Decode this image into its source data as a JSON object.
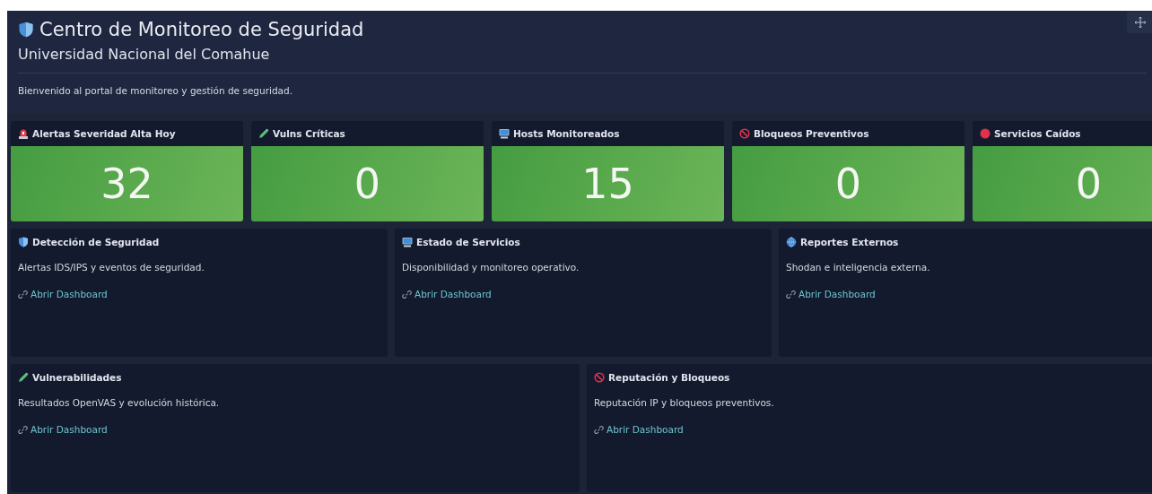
{
  "header": {
    "title": "Centro de Monitoreo de Seguridad",
    "subtitle": "Universidad Nacional del Comahue",
    "welcome": "Bienvenido al portal de monitoreo y gestión de seguridad."
  },
  "stats": [
    {
      "kind": "siren",
      "label": "Alertas Severidad Alta Hoy",
      "value": "32"
    },
    {
      "kind": "pencil",
      "label": "Vulns Críticas",
      "value": "0"
    },
    {
      "kind": "computer",
      "label": "Hosts Monitoreados",
      "value": "15"
    },
    {
      "kind": "prohibited",
      "label": "Bloqueos Preventivos",
      "value": "0"
    },
    {
      "kind": "dot",
      "label": "Servicios Caídos",
      "value": "0"
    }
  ],
  "section_rows": [
    {
      "cards": [
        {
          "kind": "shield",
          "title": "Detección de Seguridad",
          "description": "Alertas IDS/IPS y eventos de seguridad.",
          "link": "Abrir Dashboard"
        },
        {
          "kind": "computer",
          "title": "Estado de Servicios",
          "description": "Disponibilidad y monitoreo operativo.",
          "link": "Abrir Dashboard"
        },
        {
          "kind": "globe",
          "title": "Reportes Externos",
          "description": "Shodan e inteligencia externa.",
          "link": "Abrir Dashboard"
        }
      ]
    },
    {
      "cards": [
        {
          "kind": "pencil",
          "title": "Vulnerabilidades",
          "description": "Resultados OpenVAS y evolución histórica.",
          "link": "Abrir Dashboard"
        },
        {
          "kind": "prohibited",
          "title": "Reputación y Bloqueos",
          "description": "Reputación IP y bloqueos preventivos.",
          "link": "Abrir Dashboard"
        }
      ]
    }
  ]
}
